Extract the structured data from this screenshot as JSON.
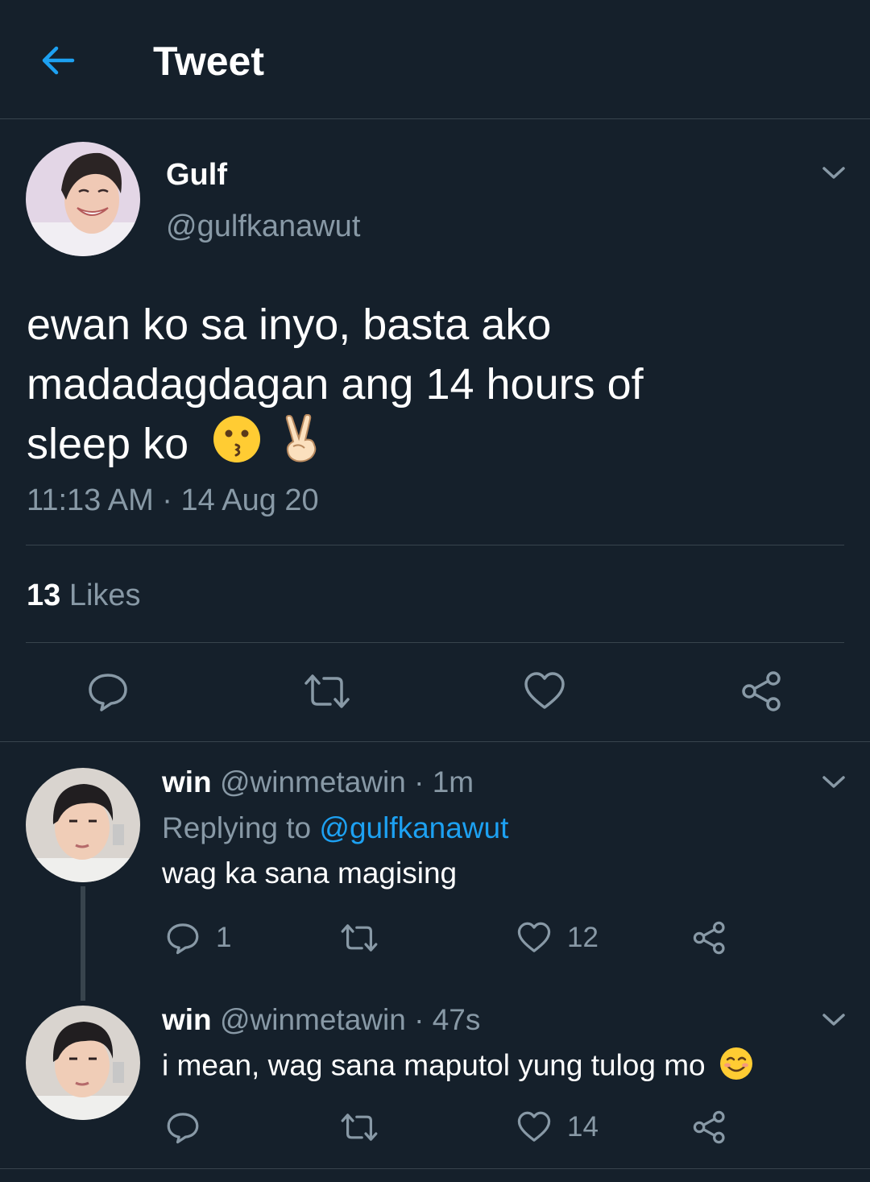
{
  "header": {
    "title": "Tweet",
    "back_icon": "arrow-left-icon"
  },
  "tweet": {
    "author_name": "Gulf",
    "author_handle": "@gulfkanawut",
    "text_line1": "ewan ko sa inyo, basta ako",
    "text_line2": "madadagdagan ang 14 hours of",
    "text_line3": "sleep ko",
    "emojis": [
      "kissing-face",
      "victory-hand"
    ],
    "timestamp": "11:13 AM · 14 Aug 20",
    "likes_count": "13",
    "likes_label": "Likes",
    "actions": [
      "reply-icon",
      "retweet-icon",
      "like-icon",
      "share-icon"
    ]
  },
  "replies": [
    {
      "name": "win",
      "handle": "@winmetawin",
      "time": "· 1m",
      "replying_prefix": "Replying to",
      "replying_to": "@gulfkanawut",
      "text": "wag ka sana magising",
      "reply_count": "1",
      "retweet_count": "",
      "like_count": "12"
    },
    {
      "name": "win",
      "handle": "@winmetawin",
      "time": "· 47s",
      "text": "i mean, wag sana maputol yung tulog mo",
      "emoji": "smiling-face-with-smiling-eyes",
      "reply_count": "",
      "retweet_count": "",
      "like_count": "14"
    }
  ],
  "colors": {
    "background": "#15202b",
    "secondary_text": "#8899a6",
    "accent": "#1da1f2",
    "divider": "#38444d"
  }
}
